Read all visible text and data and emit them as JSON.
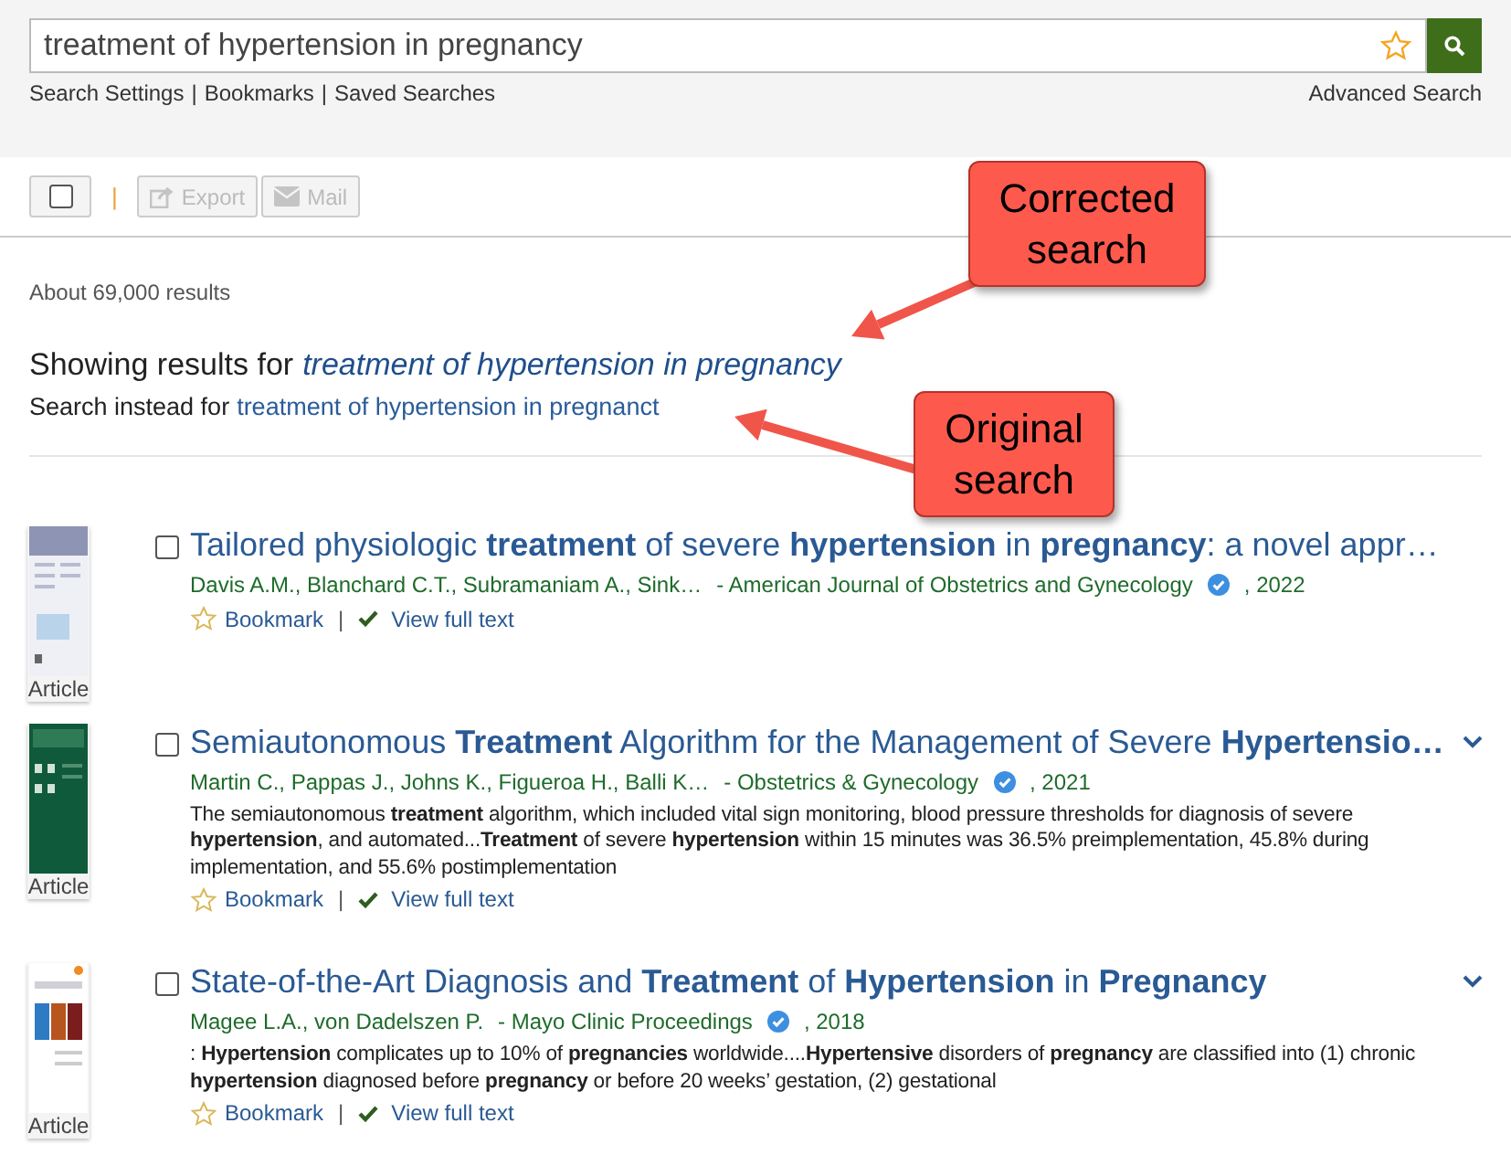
{
  "search": {
    "value": "treatment of hypertension in pregnancy",
    "links": [
      "Search Settings",
      "Bookmarks",
      "Saved Searches"
    ],
    "separator": "|",
    "advanced": "Advanced Search"
  },
  "toolbar": {
    "select_all_checked": false,
    "separator": "|",
    "buttons": [
      {
        "kind": "export",
        "label": "Export",
        "disabled": true
      },
      {
        "kind": "mail",
        "label": "Mail",
        "disabled": true
      }
    ]
  },
  "result_count": "About 69,000 results",
  "correction": {
    "showing_label": "Showing results for",
    "corrected_query": "treatment of hypertension in pregnancy",
    "instead_label": "Search instead for",
    "original_query": "treatment of hypertension in pregnanct"
  },
  "callouts": [
    {
      "kind": "corrected",
      "text": "Corrected search"
    },
    {
      "kind": "original",
      "text": "Original search"
    }
  ],
  "results": [
    {
      "badge": "Article",
      "checked": false,
      "title": "Tailored physiologic **treatment** of severe **hypertension** in **pregnancy**: a novel appr…",
      "expandable": false,
      "authors": "Davis A.M., Blanchard C.T., Subramaniam A., Sink…",
      "source": "- American Journal of Obstetrics and Gynecology",
      "year": ", 2022",
      "bookmark": "Bookmark",
      "separator": "|",
      "full_text": "View full text"
    },
    {
      "badge": "Article",
      "checked": false,
      "title": "Semiautonomous **Treatment** Algorithm for the Management of Severe **Hypertensio…**",
      "expandable": true,
      "authors": "Martin C., Pappas J., Johns K., Figueroa H., Balli K…",
      "source": "- Obstetrics & Gynecology",
      "year": ", 2021",
      "snippet": "The semiautonomous **treatment** algorithm, which included vital sign monitoring, blood pressure thresholds for diagnosis of severe **hypertension**, and automated...**Treatment** of severe **hypertension** within 15 minutes was 36.5% preimplementation, 45.8% during implementation, and 55.6% postimplementation",
      "bookmark": "Bookmark",
      "separator": "|",
      "full_text": "View full text"
    },
    {
      "badge": "Article",
      "checked": false,
      "title": "State-of-the-Art Diagnosis and **Treatment** of **Hypertension** in **Pregnancy**",
      "expandable": true,
      "authors": "Magee L.A., von Dadelszen P.",
      "source": "- Mayo Clinic Proceedings",
      "year": ", 2018",
      "snippet": ": **Hypertension** complicates up to 10% of **pregnancies** worldwide....**Hypertensive** disorders of **pregnancy** are classified into (1) chronic **hypertension** diagnosed before **pregnancy** or before 20 weeks’ gestation, (2) gestational",
      "bookmark": "Bookmark",
      "separator": "|",
      "full_text": "View full text"
    }
  ]
}
